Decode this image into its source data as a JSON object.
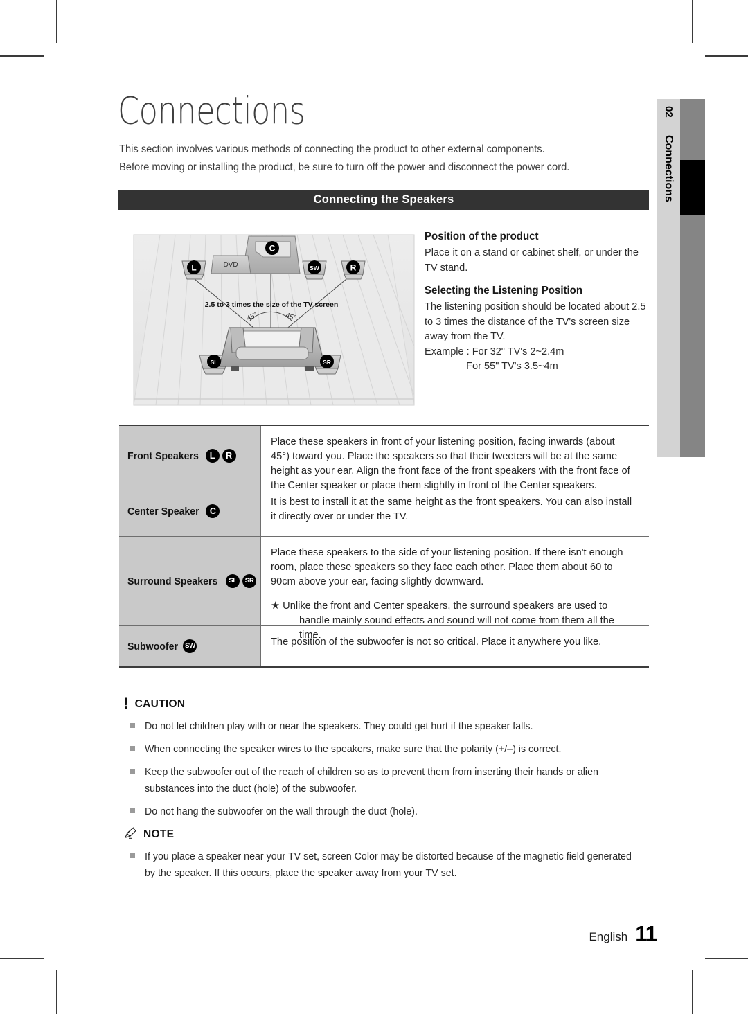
{
  "chapter": {
    "title": "Connections",
    "intro_lines": [
      "This section involves various methods of connecting the product to other external components.",
      "Before moving or installing the product, be sure to turn off the power and disconnect the power cord."
    ]
  },
  "side_tab": {
    "number": "02",
    "label": "Connections",
    "light_color": "#d3d3d3",
    "dark_color": "#858585",
    "marker_color": "#000000"
  },
  "section": {
    "header": "Connecting the Speakers",
    "header_bg": "#333333",
    "header_fg": "#ffffff"
  },
  "diagram": {
    "caption": "2.5 to 3 times the size of the TV screen",
    "angle_left": "45°",
    "angle_right": "45°",
    "dvd_label": "DVD",
    "speakers": [
      {
        "id": "L",
        "name": "front-left-speaker"
      },
      {
        "id": "C",
        "name": "center-speaker"
      },
      {
        "id": "SW",
        "name": "subwoofer"
      },
      {
        "id": "R",
        "name": "front-right-speaker"
      },
      {
        "id": "SL",
        "name": "surround-left-speaker"
      },
      {
        "id": "SR",
        "name": "surround-right-speaker"
      }
    ]
  },
  "right_column": {
    "position_heading": "Position of the product",
    "position_body": "Place it on a stand or cabinet shelf, or under the TV stand.",
    "listening_heading": "Selecting the Listening Position",
    "listening_body": "The listening position should be located about 2.5 to 3 times the distance of the TV's screen size away from the TV.",
    "example_line1": "Example : For 32\" TV's 2~2.4m",
    "example_line2": "For 55\" TV's 3.5~4m"
  },
  "table": {
    "rows": [
      {
        "label": "Front Speakers",
        "badges": [
          "L",
          "R"
        ],
        "paragraphs": [
          "Place these speakers in front of your listening position, facing inwards (about 45°) toward you. Place the speakers so that their tweeters will be at the same height as your ear. Align the front face of the front speakers with the front face of the Center speaker or place them slightly in front of the Center speakers."
        ]
      },
      {
        "label": "Center Speaker",
        "badges": [
          "C"
        ],
        "paragraphs": [
          "It is best to install it at the same height as the front speakers. You can also install it directly over or under the TV."
        ]
      },
      {
        "label": "Surround Speakers",
        "badges": [
          "SL",
          "SR"
        ],
        "paragraphs": [
          "Place these speakers to the side of your listening position. If there isn't enough room, place these speakers so they face each other. Place them about 60 to 90cm above your ear, facing slightly downward."
        ],
        "star_note_lead": "★ Unlike the front and Center speakers, the surround speakers are used to",
        "star_note_cont": "handle mainly sound effects and sound will not come from them all the time."
      },
      {
        "label": "Subwoofer",
        "badges": [
          "SW"
        ],
        "paragraphs": [
          "The position of the subwoofer is not so critical. Place it anywhere you like."
        ]
      }
    ]
  },
  "caution": {
    "title": "CAUTION",
    "icon": "exclamation-icon",
    "items": [
      "Do not let children play with or near the speakers. They could get hurt if the speaker falls.",
      "When connecting the speaker wires to the speakers, make sure that the polarity (+/–) is correct.",
      "Keep the subwoofer out of the reach of children so as to prevent them from inserting their hands or alien substances into the duct (hole) of the subwoofer.",
      "Do not hang the subwoofer on the wall through the duct (hole)."
    ]
  },
  "note": {
    "title": "NOTE",
    "icon": "pencil-icon",
    "items": [
      "If you place a speaker near your TV set, screen Color may be distorted because of the magnetic field generated by the speaker. If this occurs, place the speaker away from your TV set."
    ]
  },
  "footer": {
    "language": "English",
    "page_number": "11"
  }
}
